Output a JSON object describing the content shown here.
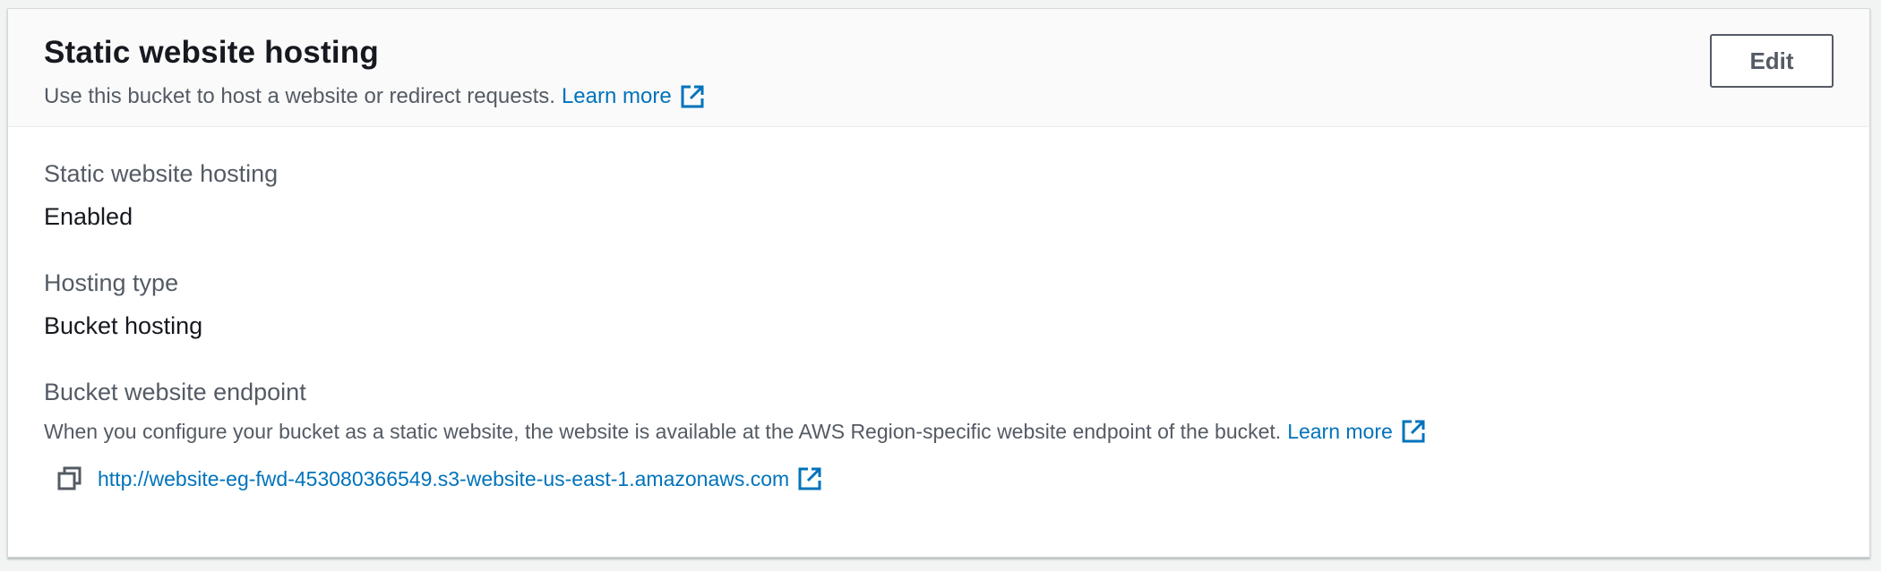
{
  "header": {
    "title": "Static website hosting",
    "description": "Use this bucket to host a website or redirect requests.",
    "learn_more": "Learn more",
    "edit_label": "Edit"
  },
  "fields": {
    "hosting": {
      "label": "Static website hosting",
      "value": "Enabled"
    },
    "type": {
      "label": "Hosting type",
      "value": "Bucket hosting"
    },
    "endpoint": {
      "label": "Bucket website endpoint",
      "description": "When you configure your bucket as a static website, the website is available at the AWS Region-specific website endpoint of the bucket.",
      "learn_more": "Learn more",
      "url": "http://website-eg-fwd-453080366549.s3-website-us-east-1.amazonaws.com"
    }
  },
  "icons": {
    "external": "external-link-icon",
    "copy": "copy-icon"
  },
  "colors": {
    "link": "#0073bb",
    "title": "#16191f",
    "secondary": "#545b64",
    "header_bg": "#fafafa"
  }
}
